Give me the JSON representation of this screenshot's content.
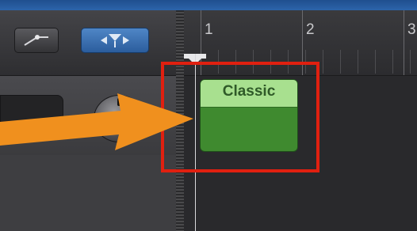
{
  "ruler": {
    "bars": [
      "1",
      "2",
      "3"
    ]
  },
  "region": {
    "name": "Classic",
    "color": "#3f8a2f",
    "header_color": "#a8e08f"
  },
  "annotation": {
    "arrow_color": "#f0901e",
    "highlight_color": "#e02010"
  },
  "icons": {
    "left_tool": "automation-curve-icon",
    "right_tool": "smart-controls-icon",
    "knob": "volume-knob-icon"
  }
}
